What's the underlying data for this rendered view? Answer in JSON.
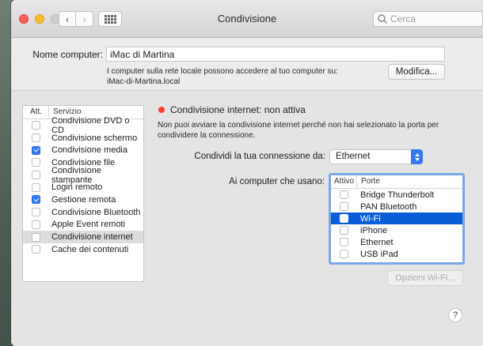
{
  "window": {
    "title": "Condivisione",
    "search_placeholder": "Cerca"
  },
  "computer_name": {
    "label": "Nome computer:",
    "value": "iMac di Martina",
    "hint_line1": "I computer sulla rete locale possono accedere al tuo computer su:",
    "hint_line2": "iMac-di-Martina.local",
    "edit_button": "Modifica..."
  },
  "services": {
    "col_on": "Att.",
    "col_service": "Servizio",
    "items": [
      {
        "label": "Condivisione DVD o CD",
        "checked": false
      },
      {
        "label": "Condivisione schermo",
        "checked": false
      },
      {
        "label": "Condivisione media",
        "checked": true
      },
      {
        "label": "Condivisione file",
        "checked": false
      },
      {
        "label": "Condivisione stampante",
        "checked": false
      },
      {
        "label": "Login remoto",
        "checked": false
      },
      {
        "label": "Gestione remota",
        "checked": true
      },
      {
        "label": "Condivisione Bluetooth",
        "checked": false
      },
      {
        "label": "Apple Event remoti",
        "checked": false
      },
      {
        "label": "Condivisione internet",
        "checked": false,
        "selected": true
      },
      {
        "label": "Cache dei contenuti",
        "checked": false
      }
    ]
  },
  "detail": {
    "status": "Condivisione internet: non attiva",
    "status_color": "#fc3c2f",
    "description": "Non puoi avviare la condivisione internet perché non hai selezionato la porta per condividere la connessione.",
    "share_label": "Condividi la tua connessione da:",
    "share_value": "Ethernet",
    "usano_label": "Ai computer che usano:",
    "ports_col_on": "Attivo",
    "ports_col_name": "Porte",
    "ports": [
      {
        "label": "Bridge Thunderbolt",
        "selected": false
      },
      {
        "label": "PAN Bluetooth",
        "selected": false
      },
      {
        "label": "Wi-Fi",
        "selected": true
      },
      {
        "label": "iPhone",
        "selected": false
      },
      {
        "label": "Ethernet",
        "selected": false
      },
      {
        "label": "USB iPad",
        "selected": false
      }
    ],
    "wifi_options_button": "Opzioni Wi-Fi...",
    "help": "?"
  },
  "colors": {
    "accent": "#3478f6",
    "selection": "#0b5dd7"
  }
}
